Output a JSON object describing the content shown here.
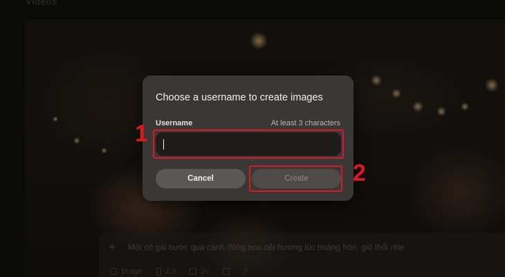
{
  "page": {
    "section_title": "Videos"
  },
  "prompt_bar": {
    "placeholder": "Một cô gái bước qua cánh đồng hoa oải hương lúc hoàng hôn, gió thổi nhẹ",
    "options": {
      "mode": "Image",
      "ratio": "2:3",
      "count": "2v",
      "help": "?"
    }
  },
  "dialog": {
    "title": "Choose a username to create images",
    "username_label": "Username",
    "username_hint": "At least 3 characters",
    "username_value": "",
    "cancel_label": "Cancel",
    "create_label": "Create"
  },
  "annotations": {
    "step1": "1",
    "step2": "2",
    "color": "#e0181f"
  },
  "colors": {
    "dialog_bg": "#3a3836",
    "input_bg": "#1e1d1c",
    "cancel_bg": "#5a5754",
    "create_bg": "#4d4a47"
  }
}
